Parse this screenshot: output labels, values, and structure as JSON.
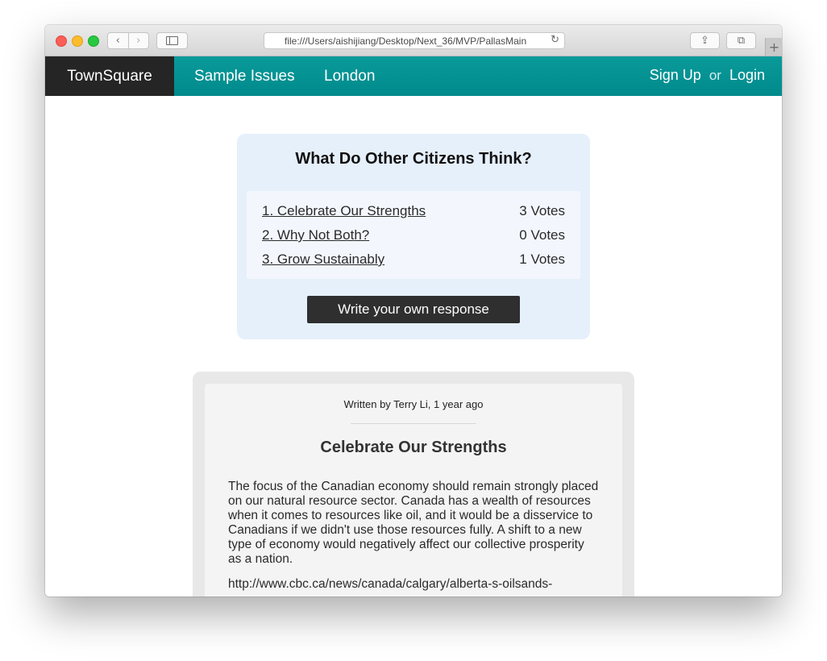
{
  "browser": {
    "url": "file:///Users/aishijiang/Desktop/Next_36/MVP/PallasMain",
    "back_icon": "‹",
    "forward_icon": "›",
    "reload_icon": "↻",
    "share_icon": "⇪",
    "tabs_icon": "⧉",
    "new_tab_icon": "+"
  },
  "nav": {
    "brand": "TownSquare",
    "links": [
      "Sample Issues",
      "London"
    ],
    "sign_up": "Sign Up",
    "or": "or",
    "login": "Login",
    "bar_color": "#009494",
    "brand_bg": "#252525"
  },
  "poll": {
    "title": "What Do Other Citizens Think?",
    "options": [
      {
        "label": "1. Celebrate Our Strengths",
        "votes": "3 Votes"
      },
      {
        "label": "2. Why Not Both?",
        "votes": "0 Votes"
      },
      {
        "label": "3. Grow Sustainably",
        "votes": "1 Votes"
      }
    ],
    "button": "Write your own response"
  },
  "response": {
    "byline": "Written by Terry Li, 1 year ago",
    "title": "Celebrate Our Strengths",
    "body": "The focus of the Canadian economy should remain strongly placed on our natural resource sector. Canada has a wealth of resources when it comes to resources like oil, and it would be a disservice to Canadians if we didn't use those resources fully. A shift to a new type of economy would negatively affect our collective prosperity as a nation.",
    "link": "http://www.cbc.ca/news/canada/calgary/alberta-s-oilsands-"
  }
}
